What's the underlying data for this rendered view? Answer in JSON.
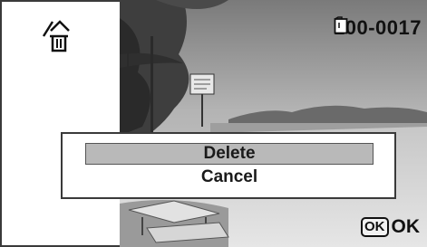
{
  "screen": {
    "mode_icon": "delete-protect-icon",
    "file_number": "100-0017",
    "folder_icon": "folder-icon",
    "ok_badge": "OK",
    "ok_label": "OK"
  },
  "dialog": {
    "items": [
      {
        "label": "Delete",
        "selected": true
      },
      {
        "label": "Cancel",
        "selected": false
      }
    ]
  },
  "colors": {
    "selected_bg": "#b9b9b9",
    "frame_border": "#3a3a3a"
  }
}
